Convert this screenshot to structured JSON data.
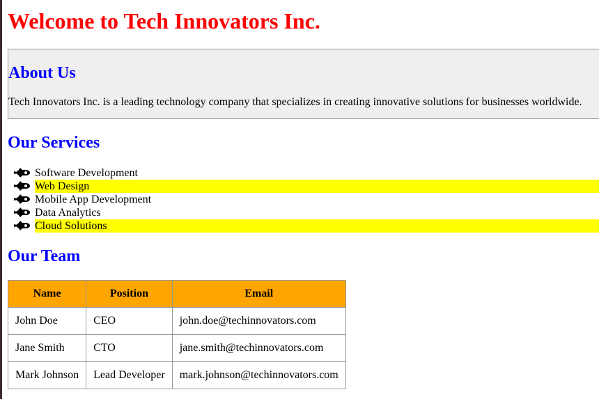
{
  "page": {
    "title": "Welcome to Tech Innovators Inc."
  },
  "about": {
    "heading": "About Us",
    "text": "Tech Innovators Inc. is a leading technology company that specializes in creating innovative solutions for businesses worldwide."
  },
  "services": {
    "heading": "Our Services",
    "bullet_icon": "rocket-icon",
    "items": [
      {
        "label": "Software Development",
        "highlighted": false
      },
      {
        "label": "Web Design",
        "highlighted": true
      },
      {
        "label": "Mobile App Development",
        "highlighted": false
      },
      {
        "label": "Data Analytics",
        "highlighted": false
      },
      {
        "label": "Cloud Solutions",
        "highlighted": true
      }
    ],
    "highlight_color": "#ffff00"
  },
  "team": {
    "heading": "Our Team",
    "columns": [
      "Name",
      "Position",
      "Email"
    ],
    "rows": [
      [
        "John Doe",
        "CEO",
        "john.doe@techinnovators.com"
      ],
      [
        "Jane Smith",
        "CTO",
        "jane.smith@techinnovators.com"
      ],
      [
        "Mark Johnson",
        "Lead Developer",
        "mark.johnson@techinnovators.com"
      ]
    ],
    "header_color": "#ffa500"
  },
  "colors": {
    "title": "#ff0000",
    "headings": "#0000ff",
    "about_bg": "#efefef"
  }
}
